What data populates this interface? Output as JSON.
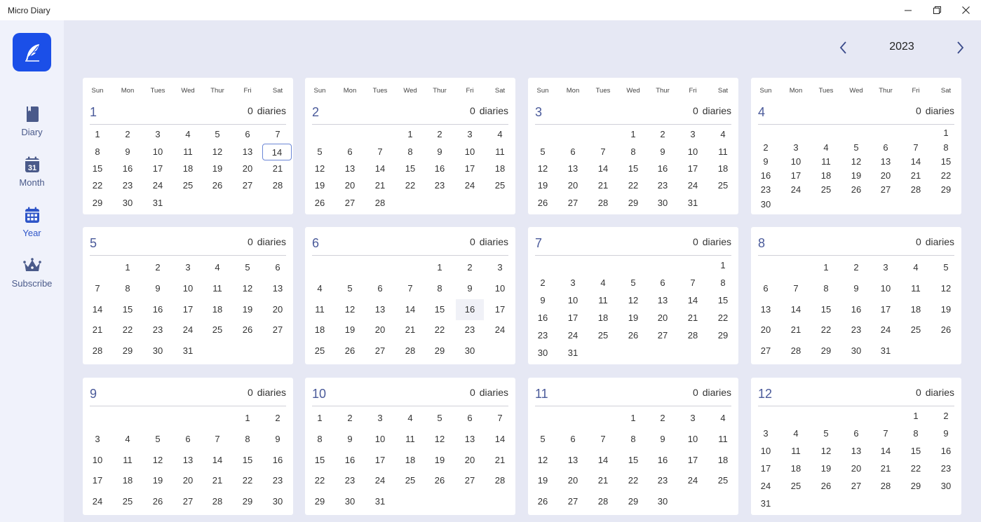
{
  "window": {
    "title": "Micro Diary"
  },
  "sidebar": {
    "items": [
      {
        "key": "diary",
        "label": "Diary",
        "icon": "notebook-icon"
      },
      {
        "key": "month",
        "label": "Month",
        "icon": "calendar-31-icon"
      },
      {
        "key": "year",
        "label": "Year",
        "icon": "calendar-grid-icon"
      },
      {
        "key": "subscribe",
        "label": "Subscribe",
        "icon": "crown-icon"
      }
    ],
    "active": "year"
  },
  "year_nav": {
    "year": "2023"
  },
  "weekdays": [
    "Sun",
    "Mon",
    "Tues",
    "Wed",
    "Thur",
    "Fri",
    "Sat"
  ],
  "diaries_label": "diaries",
  "months": [
    {
      "num": "1",
      "count": "0",
      "start": 0,
      "days": 31
    },
    {
      "num": "2",
      "count": "0",
      "start": 3,
      "days": 28
    },
    {
      "num": "3",
      "count": "0",
      "start": 3,
      "days": 31
    },
    {
      "num": "4",
      "count": "0",
      "start": 6,
      "days": 30
    },
    {
      "num": "5",
      "count": "0",
      "start": 1,
      "days": 31
    },
    {
      "num": "6",
      "count": "0",
      "start": 4,
      "days": 30
    },
    {
      "num": "7",
      "count": "0",
      "start": 6,
      "days": 31
    },
    {
      "num": "8",
      "count": "0",
      "start": 2,
      "days": 31
    },
    {
      "num": "9",
      "count": "0",
      "start": 5,
      "days": 30
    },
    {
      "num": "10",
      "count": "0",
      "start": 0,
      "days": 31
    },
    {
      "num": "11",
      "count": "0",
      "start": 3,
      "days": 30
    },
    {
      "num": "12",
      "count": "0",
      "start": 5,
      "days": 31
    }
  ],
  "today": {
    "month": 1,
    "day": 14
  },
  "hover": {
    "month": 6,
    "day": 16
  },
  "colors": {
    "accent": "#1b4fe8",
    "nav_icon": "#4a5a8a",
    "nav_active": "#2e55c8",
    "background": "#e6e8f4"
  }
}
